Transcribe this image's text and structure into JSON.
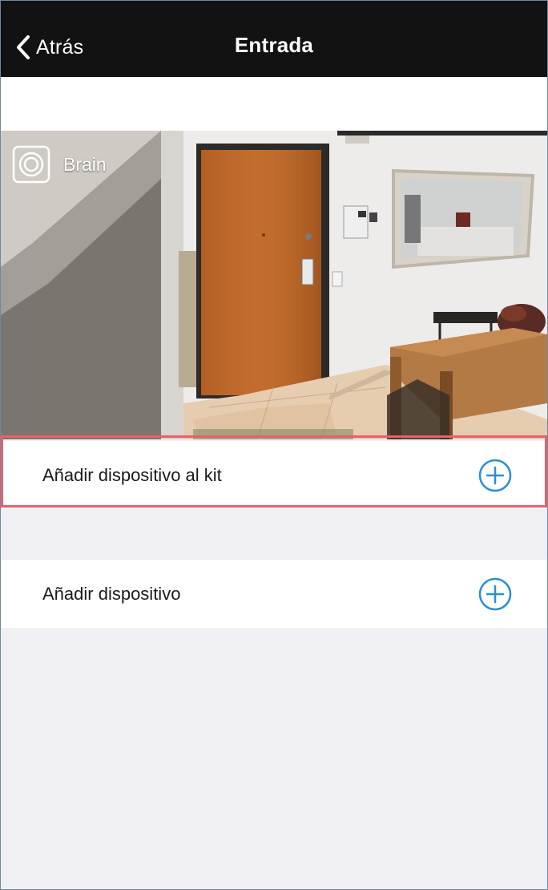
{
  "nav": {
    "back_label": "Atrás",
    "title": "Entrada"
  },
  "camera": {
    "badge_label": "Brain",
    "badge_icon": "camera-ring-icon"
  },
  "rows": [
    {
      "label": "Añadir dispositivo al kit",
      "icon": "plus-circle-icon"
    },
    {
      "label": "Añadir dispositivo",
      "icon": "plus-circle-icon"
    }
  ],
  "colors": {
    "navbar": "#121212",
    "accent": "#2a8fd6",
    "highlight": "#e8606a",
    "background": "#efeff4"
  }
}
